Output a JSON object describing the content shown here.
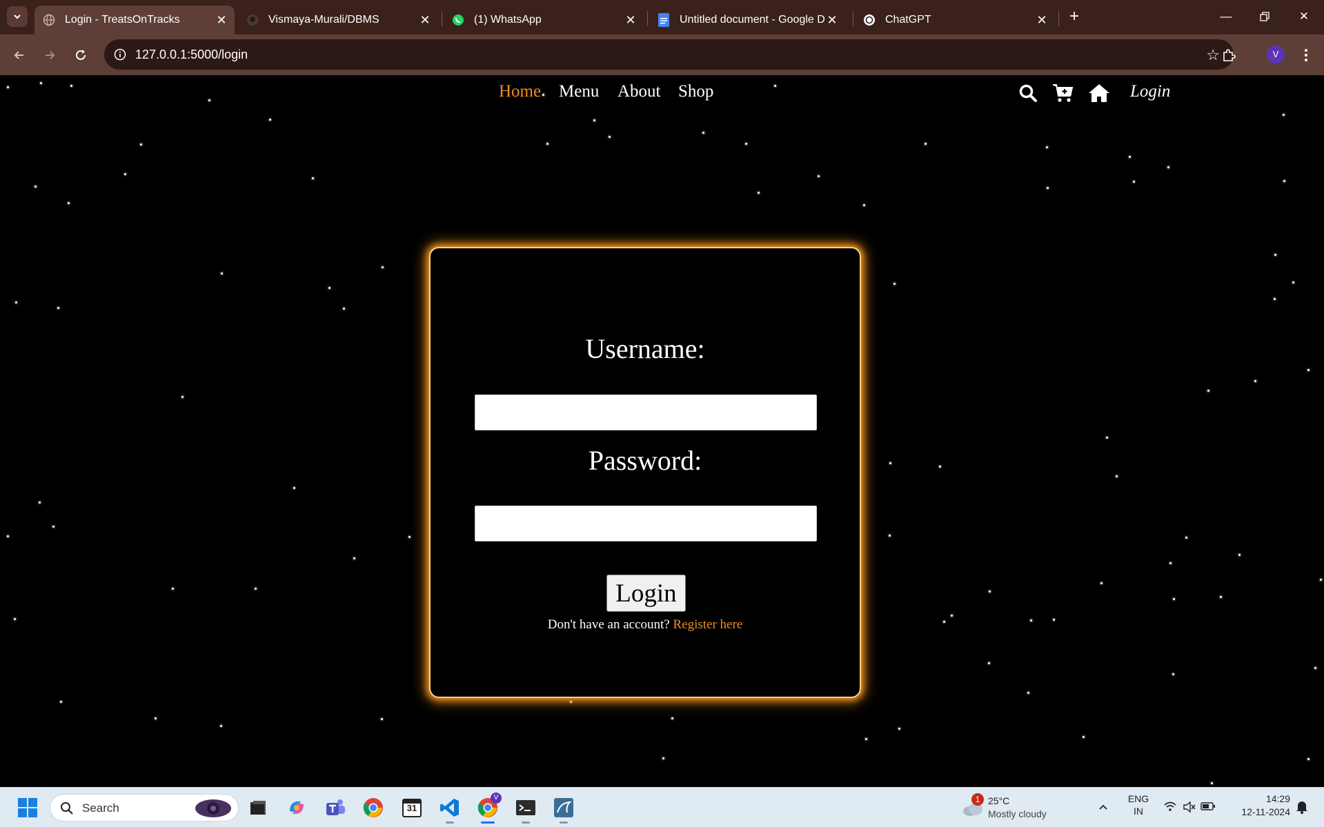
{
  "browser": {
    "tabs": [
      {
        "title": "Login - TreatsOnTracks",
        "active": true,
        "icon": "globe-icon"
      },
      {
        "title": "Vismaya-Murali/DBMS",
        "active": false,
        "icon": "github-icon"
      },
      {
        "title": "(1) WhatsApp",
        "active": false,
        "icon": "whatsapp-icon"
      },
      {
        "title": "Untitled document - Google Docs",
        "active": false,
        "icon": "google-docs-icon"
      },
      {
        "title": "ChatGPT",
        "active": false,
        "icon": "chatgpt-icon"
      }
    ],
    "url": "127.0.0.1:5000/login",
    "profile_initial": "V",
    "colors": {
      "tab_bar": "#3b211c",
      "toolbar": "#5d3f37",
      "omnibox": "#2c1814"
    }
  },
  "site": {
    "nav": {
      "links": [
        "Home",
        "Menu",
        "About",
        "Shop"
      ],
      "current": "Home",
      "login_label": "Login",
      "icons": [
        "search-icon",
        "cart-add-icon",
        "home-icon"
      ]
    },
    "form": {
      "username_label": "Username:",
      "username_value": "",
      "password_label": "Password:",
      "password_value": "",
      "submit_label": "Login",
      "register_prompt": "Don't have an account?",
      "register_link": "Register here"
    },
    "colors": {
      "accent": "#f28b1e",
      "background": "#000000",
      "card_glow": "#f29a1e"
    }
  },
  "taskbar": {
    "search_label": "Search",
    "apps": [
      "file-explorer-icon",
      "copilot-icon",
      "teams-icon",
      "chrome-icon",
      "calendar-icon",
      "vscode-icon",
      "chrome-profile-icon",
      "terminal-icon",
      "mysql-workbench-icon"
    ],
    "calendar_day": "31",
    "weather": {
      "badge": "1",
      "temp": "25°C",
      "condition": "Mostly cloudy"
    },
    "language": {
      "line1": "ENG",
      "line2": "IN"
    },
    "clock": {
      "time": "14:29",
      "date": "12-11-2024"
    }
  }
}
